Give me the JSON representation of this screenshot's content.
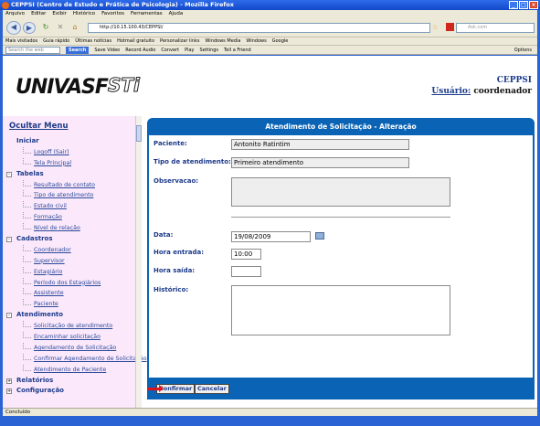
{
  "window": {
    "title": "CEPPSI (Centro de Estudo e Prática de Psicologia) - Mozilla Firefox",
    "controls": [
      "_",
      "□",
      "×"
    ]
  },
  "menubar": [
    "Arquivo",
    "Editar",
    "Exibir",
    "Histórico",
    "Favoritos",
    "Ferramentas",
    "Ajuda"
  ],
  "nav": {
    "url": "http://10.15.100.43/CEPPSI/",
    "search_placeholder": "Ask.com"
  },
  "bookmarks": [
    "Mais visitados",
    "Guia rápido",
    "Últimas notícias",
    "Hotmail gratuito",
    "Personalizar links",
    "Windows Media",
    "Windows",
    "Google"
  ],
  "toolbar2": {
    "search_placeholder": "Search the web",
    "search_button": "Search",
    "items": [
      "Save Video",
      "Record Audio",
      "Convert",
      "Play",
      "Settings",
      "Tell a Friend"
    ],
    "options": "Options"
  },
  "header": {
    "logo_text": "UNIVASF",
    "logo2_text": "STi",
    "app_name": "CEPPSI",
    "user_label": "Usuário:",
    "user_value": "coordenador"
  },
  "sidebar": {
    "hide_menu": "Ocultar Menu",
    "tree": [
      {
        "type": "root",
        "label": "Iniciar",
        "expander": ""
      },
      {
        "type": "leaf",
        "label": "Logoff (Sair)"
      },
      {
        "type": "leaf",
        "label": "Tela Principal"
      },
      {
        "type": "root",
        "label": "Tabelas",
        "expander": "-"
      },
      {
        "type": "leaf",
        "label": "Resultado de contato"
      },
      {
        "type": "leaf",
        "label": "Tipo de atendimento"
      },
      {
        "type": "leaf",
        "label": "Estado civil"
      },
      {
        "type": "leaf",
        "label": "Formação"
      },
      {
        "type": "leaf",
        "label": "Nível de relação"
      },
      {
        "type": "root",
        "label": "Cadastros",
        "expander": "-"
      },
      {
        "type": "leaf",
        "label": "Coordenador"
      },
      {
        "type": "leaf",
        "label": "Supervisor"
      },
      {
        "type": "leaf",
        "label": "Estagiário"
      },
      {
        "type": "leaf",
        "label": "Período dos Estagiários"
      },
      {
        "type": "leaf",
        "label": "Assistente"
      },
      {
        "type": "leaf",
        "label": "Paciente"
      },
      {
        "type": "root",
        "label": "Atendimento",
        "expander": "-"
      },
      {
        "type": "leaf",
        "label": "Solicitação de atendimento"
      },
      {
        "type": "leaf",
        "label": "Encaminhar solicitação"
      },
      {
        "type": "leaf",
        "label": "Agendamento de Solicitação"
      },
      {
        "type": "leaf",
        "label": "Confirmar Agendamento de Solicitação"
      },
      {
        "type": "leaf",
        "label": "Atendimento de Paciente"
      },
      {
        "type": "root",
        "label": "Relatórios",
        "expander": "+"
      },
      {
        "type": "root",
        "label": "Configuração",
        "expander": "+"
      }
    ]
  },
  "form": {
    "title": "Atendimento de Solicitação - Alteração",
    "paciente_label": "Paciente:",
    "paciente_value": "Antonito Ratintim",
    "tipo_label": "Tipo de atendimento:",
    "tipo_value": "Primeiro atendimento",
    "obs_label": "Observacao:",
    "obs_value": "",
    "data_label": "Data:",
    "data_value": "19/08/2009",
    "hora_entrada_label": "Hora entrada:",
    "hora_entrada_value": "10:00",
    "hora_saida_label": "Hora saída:",
    "hora_saida_value": "",
    "historico_label": "Histórico:",
    "historico_value": "",
    "confirm_button": "Confirmar",
    "cancel_button": "Cancelar"
  },
  "status": {
    "text": "Concluído"
  }
}
